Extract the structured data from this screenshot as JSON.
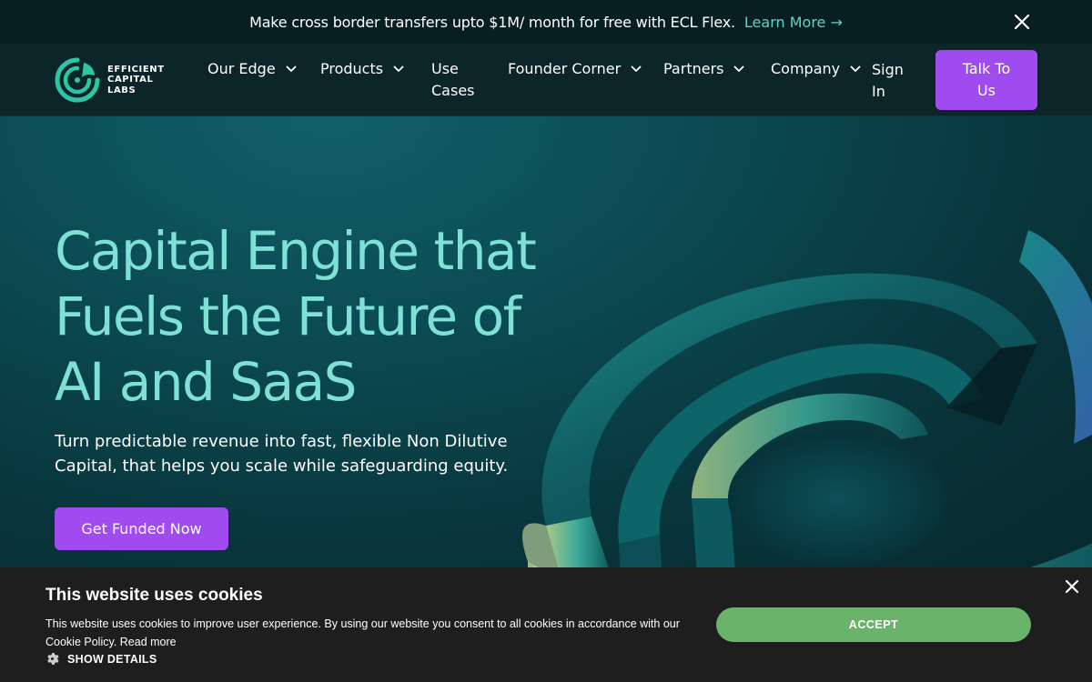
{
  "announcement": {
    "message": "Make cross border transfers upto $1M/ month for free with ECL Flex.",
    "link_label": "Learn More →"
  },
  "brand": {
    "line1": "EFFICIENT",
    "line2": "CAPITAL",
    "line3": "LABS",
    "logo_color": "#2ec4a6"
  },
  "nav": {
    "items": [
      {
        "label": "Our Edge",
        "has_dropdown": true
      },
      {
        "label": "Products",
        "has_dropdown": true
      },
      {
        "label": "Use Cases",
        "has_dropdown": false
      },
      {
        "label": "Founder Corner",
        "has_dropdown": true
      },
      {
        "label": "Partners",
        "has_dropdown": true
      },
      {
        "label": "Company",
        "has_dropdown": true
      },
      {
        "label": "Sign In",
        "has_dropdown": false
      }
    ],
    "cta_label": "Talk To Us"
  },
  "hero": {
    "title": "Capital Engine that Fuels the Future of AI and SaaS",
    "subtitle": "Turn predictable revenue into fast, flexible Non Dilutive Capital, that helps you scale while safeguarding equity.",
    "cta_label": "Get Funded Now"
  },
  "cookie": {
    "title": "This website uses cookies",
    "text": "This website uses cookies to improve user experience. By using our website you consent to all cookies in accordance with our Cookie Policy.",
    "read_more": "Read more",
    "show_details": "SHOW DETAILS",
    "accept": "ACCEPT"
  },
  "colors": {
    "accent_purple": "#a04bf0",
    "hero_heading": "#7fe0d6",
    "link_teal": "#5fd3c8",
    "accept_green": "#6ab36a"
  },
  "icons": [
    "close-icon",
    "chevron-down-icon",
    "gear-icon",
    "logo-icon"
  ]
}
